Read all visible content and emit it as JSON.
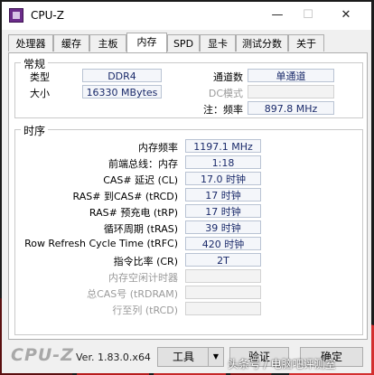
{
  "window": {
    "title": "CPU-Z"
  },
  "tabs": [
    {
      "label": "处理器"
    },
    {
      "label": "缓存"
    },
    {
      "label": "主板"
    },
    {
      "label": "内存"
    },
    {
      "label": "SPD"
    },
    {
      "label": "显卡"
    },
    {
      "label": "测试分数"
    },
    {
      "label": "关于"
    }
  ],
  "active_tab": "内存",
  "general": {
    "title": "常规",
    "type_label": "类型",
    "type_value": "DDR4",
    "size_label": "大小",
    "size_value": "16330 MBytes",
    "channel_label": "通道数",
    "channel_value": "单通道",
    "dc_mode_label": "DC模式",
    "dc_mode_value": "",
    "note_freq_label": "注：频率",
    "note_freq_value": "897.8 MHz"
  },
  "timings": {
    "title": "时序",
    "rows": [
      {
        "label": "内存频率",
        "value": "1197.1 MHz",
        "disabled": false
      },
      {
        "label": "前端总线：内存",
        "value": "1:18",
        "disabled": false
      },
      {
        "label": "CAS# 延迟 (CL)",
        "value": "17.0 时钟",
        "disabled": false
      },
      {
        "label": "RAS# 到CAS# (tRCD)",
        "value": "17 时钟",
        "disabled": false
      },
      {
        "label": "RAS# 预充电 (tRP)",
        "value": "17 时钟",
        "disabled": false
      },
      {
        "label": "循环周期 (tRAS)",
        "value": "39 时钟",
        "disabled": false
      },
      {
        "label": "Row Refresh Cycle Time (tRFC)",
        "value": "420 时钟",
        "disabled": false
      },
      {
        "label": "指令比率 (CR)",
        "value": "2T",
        "disabled": false
      },
      {
        "label": "内存空闲计时器",
        "value": "",
        "disabled": true
      },
      {
        "label": "总CAS号 (tRDRAM)",
        "value": "",
        "disabled": true
      },
      {
        "label": "行至列 (tRCD)",
        "value": "",
        "disabled": true
      }
    ]
  },
  "footer": {
    "brand": "CPU-Z",
    "version": "Ver. 1.83.0.x64",
    "tools_label": "工具",
    "validate_label": "验证",
    "ok_label": "确定"
  },
  "watermark": "头条号 / 电脑吧评测室"
}
